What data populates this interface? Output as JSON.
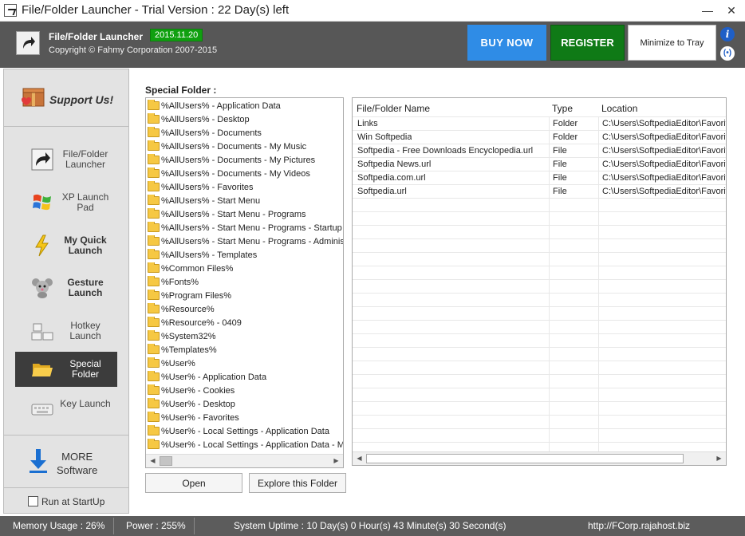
{
  "window": {
    "title": "File/Folder Launcher - Trial Version : 22 Day(s) left",
    "minimize": "—",
    "close": "✕"
  },
  "header": {
    "app_name": "File/Folder Launcher",
    "version": "2015.11.20",
    "copyright": "Copyright © Fahmy Corporation 2007-2015",
    "buy_label": "BUY NOW",
    "register_label": "REGISTER",
    "tray_label": "Minimize to Tray",
    "info_glyph": "i",
    "net_glyph": "(•)",
    "colors": {
      "header_bg": "#575757",
      "buy": "#2f8ce6",
      "register": "#0f7a16",
      "version_badge": "#10a010"
    }
  },
  "sidebar": {
    "support_label": "Support Us!",
    "items": [
      {
        "label": "File/Folder Launcher",
        "icon": "shortcut-arrow-icon",
        "active": false,
        "bold": false
      },
      {
        "label": "XP Launch Pad",
        "icon": "windows-xp-icon",
        "active": false,
        "bold": false
      },
      {
        "label": "My Quick Launch",
        "icon": "lightning-icon",
        "active": false,
        "bold": true
      },
      {
        "label": "Gesture Launch",
        "icon": "mouse-mascot-icon",
        "active": false,
        "bold": true
      },
      {
        "label": "Hotkey Launch",
        "icon": "keyboard-keys-icon",
        "active": false,
        "bold": false
      },
      {
        "label": "Special Folder",
        "icon": "folder-icon",
        "active": true,
        "bold": false
      },
      {
        "label": "Key Launch",
        "icon": "keyboard-icon",
        "active": false,
        "bold": false
      }
    ],
    "more_label_1": "MORE",
    "more_label_2": "Software",
    "startup_label": "Run at StartUp"
  },
  "special_folder": {
    "label": "Special Folder :",
    "items": [
      "%AllUsers% - Application Data",
      "%AllUsers% - Desktop",
      "%AllUsers% - Documents",
      "%AllUsers% - Documents - My Music",
      "%AllUsers% - Documents - My Pictures",
      "%AllUsers% - Documents - My Videos",
      "%AllUsers% - Favorites",
      "%AllUsers% - Start Menu",
      "%AllUsers% - Start Menu  - Programs",
      "%AllUsers% - Start Menu  - Programs - Startup",
      "%AllUsers% - Start Menu - Programs - Administrat",
      "%AllUsers% - Templates",
      "%Common Files%",
      "%Fonts%",
      "%Program Files%",
      "%Resource%",
      "%Resource% - 0409",
      "%System32%",
      "%Templates%",
      "%User%",
      "%User% - Application Data",
      "%User% - Cookies",
      "%User% - Desktop",
      "%User% - Favorites",
      "%User% - Local Settings - Application Data",
      "%User% - Local Settings - Application Data - Micr"
    ],
    "open_label": "Open",
    "explore_label": "Explore this Folder"
  },
  "file_table": {
    "columns": [
      "File/Folder Name",
      "Type",
      "Location"
    ],
    "rows": [
      [
        "Links",
        "Folder",
        "C:\\Users\\SoftpediaEditor\\Favorit"
      ],
      [
        "Win Softpedia",
        "Folder",
        "C:\\Users\\SoftpediaEditor\\Favorit"
      ],
      [
        "Softpedia - Free Downloads Encyclopedia.url",
        "File",
        "C:\\Users\\SoftpediaEditor\\Favorit"
      ],
      [
        "Softpedia News.url",
        "File",
        "C:\\Users\\SoftpediaEditor\\Favorit"
      ],
      [
        "Softpedia.com.url",
        "File",
        "C:\\Users\\SoftpediaEditor\\Favorit"
      ],
      [
        "Softpedia.url",
        "File",
        "C:\\Users\\SoftpediaEditor\\Favorit"
      ]
    ]
  },
  "status": {
    "memory": "Memory Usage : 26%",
    "power": "Power : 255%",
    "uptime": "System Uptime : 10 Day(s) 0 Hour(s) 43 Minute(s) 30 Second(s)",
    "url": "http://FCorp.rajahost.biz"
  }
}
